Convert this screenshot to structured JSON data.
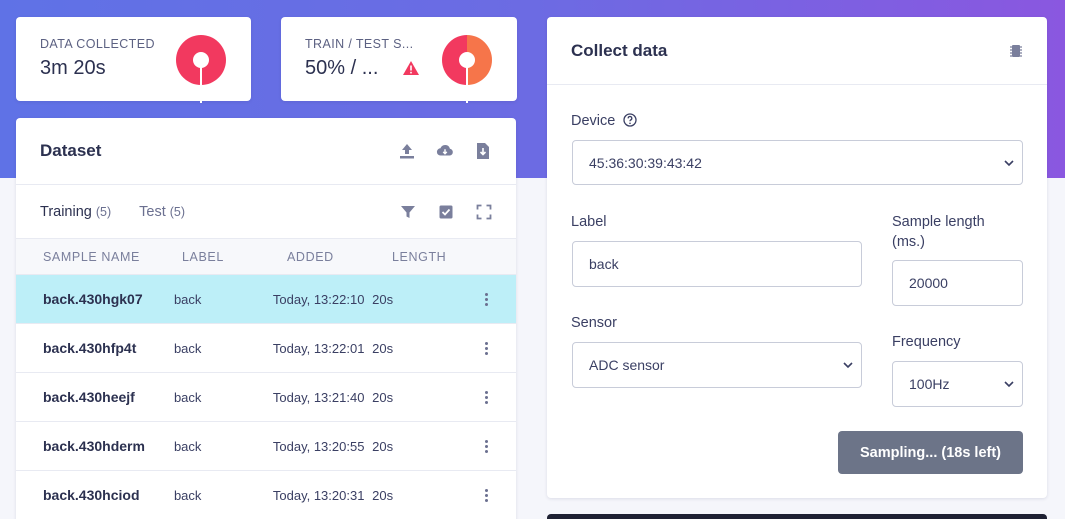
{
  "stats": {
    "data_collected": {
      "label": "DATA COLLECTED",
      "value": "3m 20s"
    },
    "train_test": {
      "label": "TRAIN / TEST S...",
      "value": "50% / ..."
    }
  },
  "colors": {
    "accent_red": "#f2395f",
    "accent_orange": "#f6754a",
    "selected_row": "#bdeff8",
    "button_gray": "#6c7488"
  },
  "dataset": {
    "title": "Dataset",
    "tabs": [
      {
        "label": "Training",
        "count": "(5)"
      },
      {
        "label": "Test",
        "count": "(5)"
      }
    ],
    "columns": [
      "SAMPLE NAME",
      "LABEL",
      "ADDED",
      "LENGTH"
    ],
    "rows": [
      {
        "name": "back.430hgk07",
        "label": "back",
        "added": "Today, 13:22:10",
        "length": "20s"
      },
      {
        "name": "back.430hfp4t",
        "label": "back",
        "added": "Today, 13:22:01",
        "length": "20s"
      },
      {
        "name": "back.430heejf",
        "label": "back",
        "added": "Today, 13:21:40",
        "length": "20s"
      },
      {
        "name": "back.430hderm",
        "label": "back",
        "added": "Today, 13:20:55",
        "length": "20s"
      },
      {
        "name": "back.430hciod",
        "label": "back",
        "added": "Today, 13:20:31",
        "length": "20s"
      }
    ]
  },
  "collect": {
    "title": "Collect data",
    "device_label": "Device",
    "device_value": "45:36:30:39:43:42",
    "label_label": "Label",
    "label_value": "back",
    "sample_length_label": "Sample length (ms.)",
    "sample_length_value": "20000",
    "sensor_label": "Sensor",
    "sensor_value": "ADC sensor",
    "frequency_label": "Frequency",
    "frequency_value": "100Hz",
    "sampling_button": "Sampling... (18s left)"
  }
}
